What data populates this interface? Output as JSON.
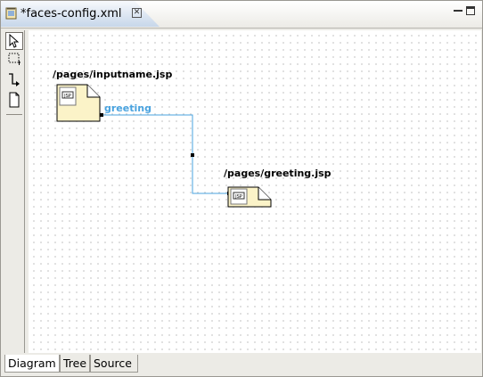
{
  "editor": {
    "tab_title": "*faces-config.xml",
    "tab_icon": "faces-config-file-icon",
    "close_icon": "close-icon"
  },
  "window_controls": {
    "minimize": "minimize-icon",
    "maximize": "maximize-icon"
  },
  "palette": {
    "tools": [
      {
        "name": "select-tool",
        "icon": "arrow-pointer-icon"
      },
      {
        "name": "marquee-tool",
        "icon": "marquee-icon"
      },
      {
        "name": "connection-tool",
        "icon": "connection-icon"
      },
      {
        "name": "page-tool",
        "icon": "page-icon"
      }
    ]
  },
  "diagram": {
    "nodes": [
      {
        "label": "/pages/inputname.jsp",
        "icon": "jsp-page-icon"
      },
      {
        "label": "/pages/greeting.jsp",
        "icon": "jsp-page-icon"
      }
    ],
    "navigation_rule": {
      "label": "greeting",
      "color": "#4aa3df"
    }
  },
  "bottom_tabs": [
    "Diagram",
    "Tree",
    "Source"
  ],
  "colors": {
    "canvas_background": "#ffffff",
    "page_fill": "#fbf3c8",
    "link": "#4aa3df"
  }
}
